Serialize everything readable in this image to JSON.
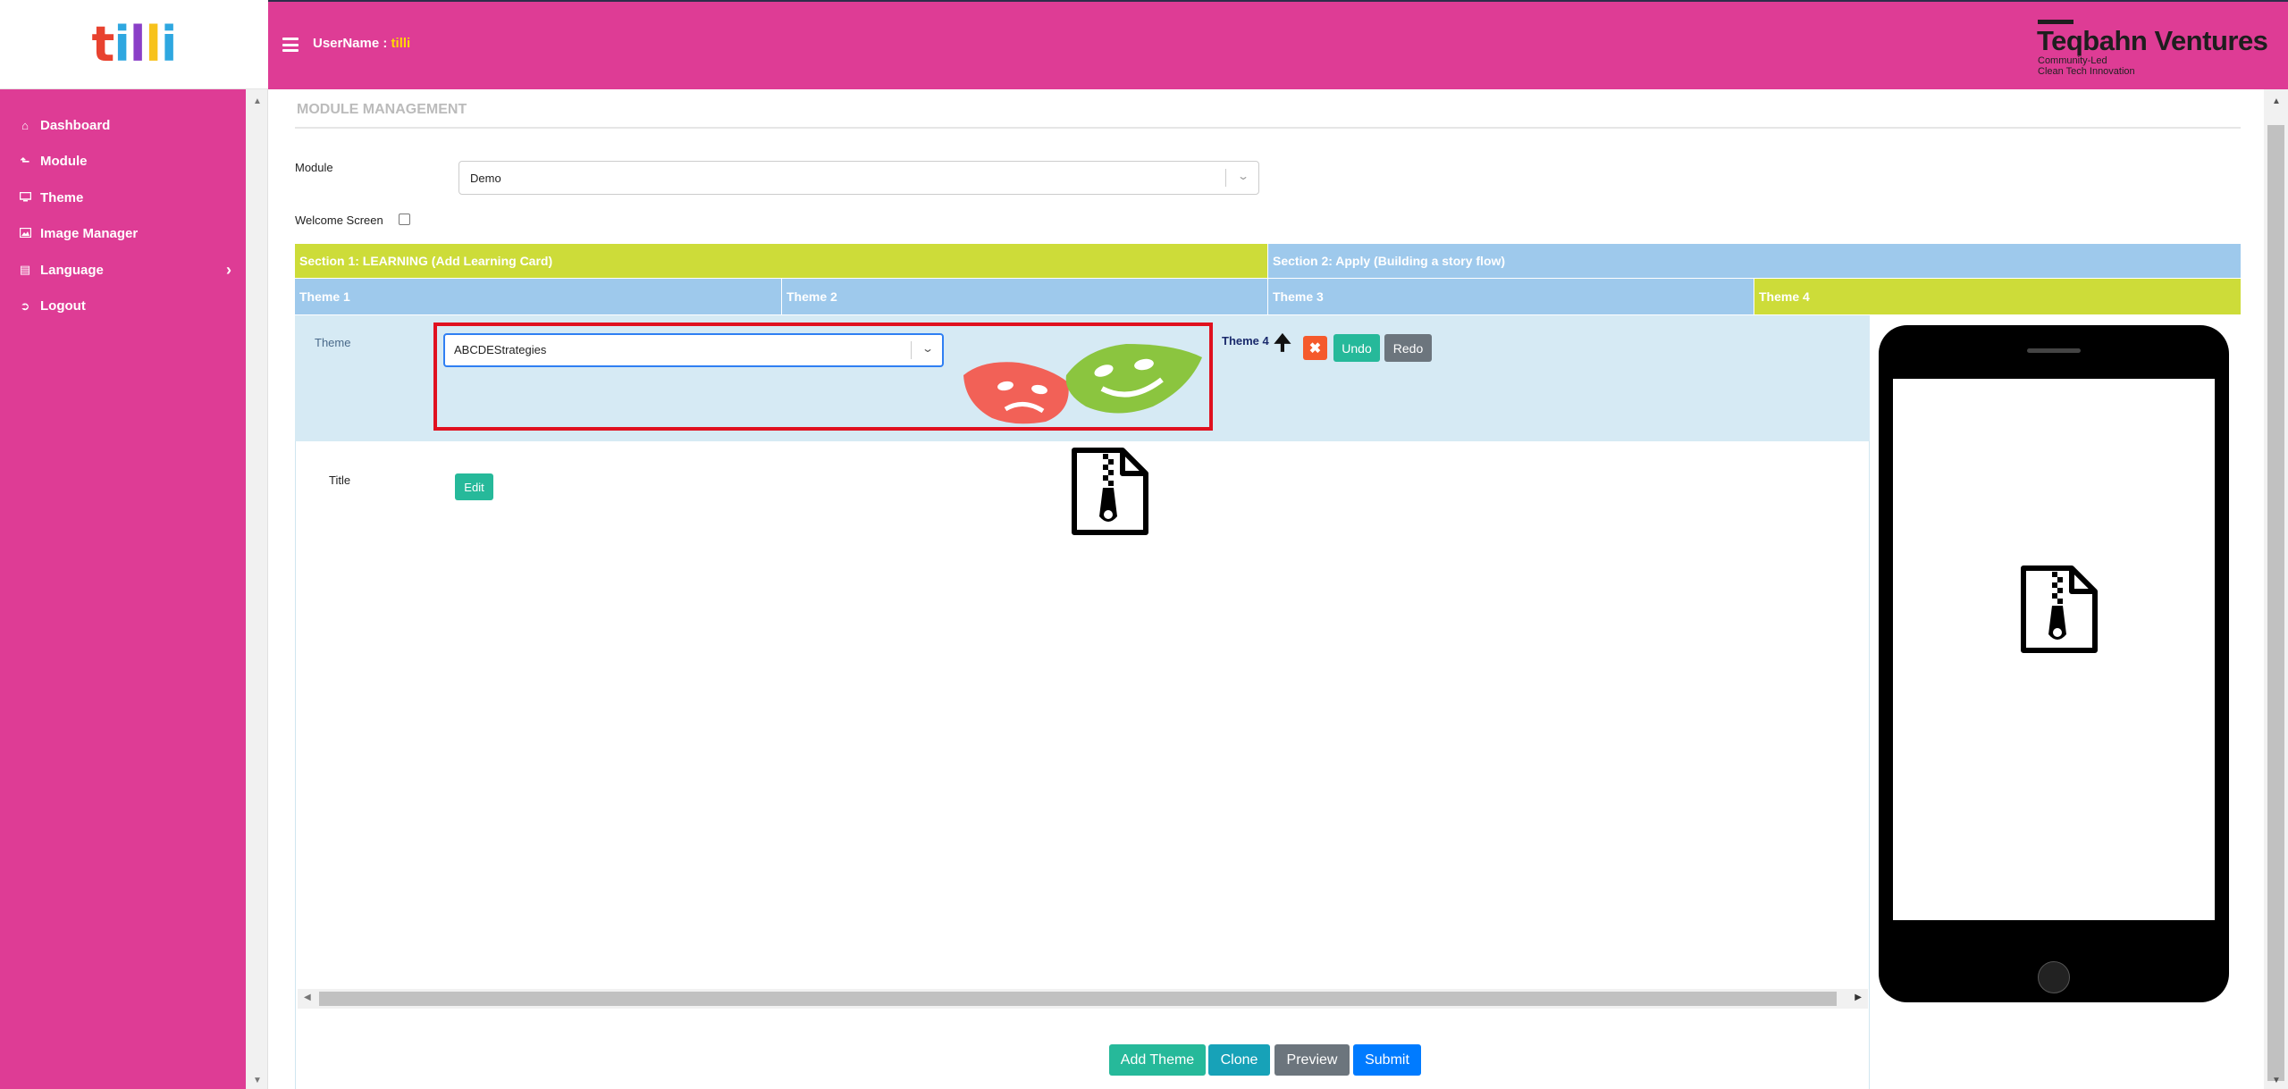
{
  "logo": {
    "letters": [
      "t",
      "i",
      "l",
      "l",
      "i"
    ],
    "colors": [
      "#e8422f",
      "#2ea7e0",
      "#8a3fc7",
      "#f7c21b",
      "#2ea7e0"
    ]
  },
  "header": {
    "username_label": "UserName :",
    "username_value": "tilli",
    "brand_name": "Teqbahn Ventures",
    "brand_tagline_1": "Community-Led",
    "brand_tagline_2": "Clean Tech Innovation"
  },
  "sidebar": {
    "items": [
      {
        "label": "Dashboard",
        "icon": "home-icon"
      },
      {
        "label": "Module",
        "icon": "level-up-icon"
      },
      {
        "label": "Theme",
        "icon": "desktop-icon"
      },
      {
        "label": "Image Manager",
        "icon": "image-icon"
      },
      {
        "label": "Language",
        "icon": "language-icon"
      },
      {
        "label": "Logout",
        "icon": "sign-out-icon"
      }
    ]
  },
  "page": {
    "title": "MODULE MANAGEMENT",
    "module_label": "Module",
    "module_value": "Demo",
    "welcome_label": "Welcome Screen",
    "welcome_checked": false
  },
  "sections": [
    {
      "label": "Section 1: LEARNING (Add Learning Card)",
      "color": "#cddc39"
    },
    {
      "label": "Section 2: Apply (Building a story flow)",
      "color": "#9ec9ec"
    }
  ],
  "themes": [
    {
      "label": "Theme 1",
      "color": "#9ec9ec"
    },
    {
      "label": "Theme 2",
      "color": "#9ec9ec"
    },
    {
      "label": "Theme 3",
      "color": "#9ec9ec"
    },
    {
      "label": "Theme 4",
      "color": "#cddc39"
    }
  ],
  "editor": {
    "theme_label": "Theme",
    "theme_select_value": "ABCDEStrategies",
    "current_theme": "Theme 4",
    "undo_label": "Undo",
    "redo_label": "Redo",
    "title_label": "Title",
    "edit_label": "Edit"
  },
  "actions": {
    "add_theme": "Add Theme",
    "clone": "Clone",
    "preview": "Preview",
    "submit": "Submit"
  },
  "colors": {
    "brand_pink": "#de3c95",
    "highlight_red": "#e0111f",
    "success": "#26b99a",
    "info": "#17a2b8",
    "secondary": "#6c757d",
    "primary": "#007bff"
  }
}
